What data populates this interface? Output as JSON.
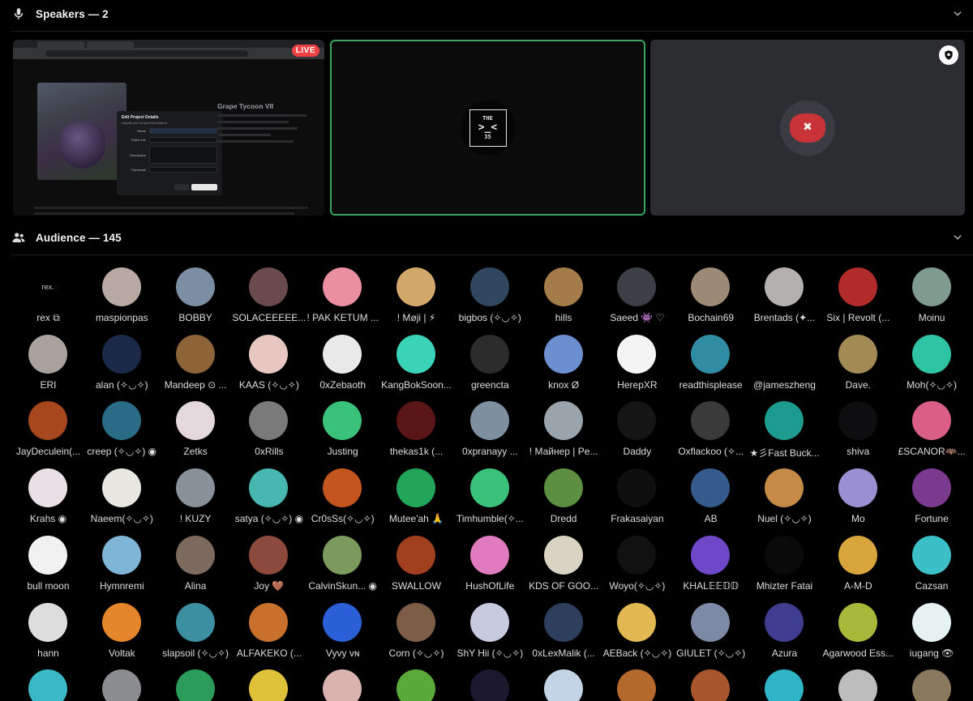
{
  "speakers": {
    "title": "Speakers — 2",
    "icon": "microphone-icon",
    "screen_share": {
      "live_label": "LIVE",
      "side_title": "Grape Tycoon VII",
      "modal_title": "Edit Project Details",
      "modal_subtitle": "Update your project information",
      "field_labels": [
        "Name",
        "Token Info",
        "Description",
        "Thumbnail"
      ],
      "cancel_label": "Cancel",
      "update_label": "Update Project"
    },
    "tiles": [
      {
        "logo_top": "THE",
        "logo_mid": ">_<",
        "logo_bottom": "35",
        "speaking": true
      },
      {
        "moderator": true
      }
    ]
  },
  "audience": {
    "title": "Audience — 145",
    "icon": "people-icon",
    "first_avatar_text": "rex.",
    "members": [
      {
        "name": "rex ⧉",
        "color": "#000000"
      },
      {
        "name": "maspionpas",
        "color": "#b9a9a3"
      },
      {
        "name": "BOBBY",
        "color": "#7c8ea3"
      },
      {
        "name": "SOLACEEEEE...",
        "color": "#6b4a4e"
      },
      {
        "name": "! PAK KETUM ...",
        "color": "#e98fa0"
      },
      {
        "name": "! Møji | ⚡",
        "color": "#d2a86b"
      },
      {
        "name": "bigbos (✧◡✧)",
        "color": "#31465f"
      },
      {
        "name": "hills",
        "color": "#a47c4a"
      },
      {
        "name": "Saeed 👾 ♡",
        "color": "#3c4046"
      },
      {
        "name": "Bochain69",
        "color": "#9c8a76"
      },
      {
        "name": "Brentads (✦...",
        "color": "#b3b0ae"
      },
      {
        "name": "Six | Revolt (...",
        "color": "#b22b2b"
      },
      {
        "name": "Moinu",
        "color": "#7f9a8f"
      },
      {
        "name": "ERI",
        "color": "#a9a29c"
      },
      {
        "name": "alan (✧◡✧)",
        "color": "#1c2a4a"
      },
      {
        "name": "Mandeep ⊙ ...",
        "color": "#8c6438"
      },
      {
        "name": "KAAS (✧◡✧)",
        "color": "#e8c7c2"
      },
      {
        "name": "0xZebaoth",
        "color": "#e9e9e9"
      },
      {
        "name": "KangBokSoon...",
        "color": "#3bd3b8"
      },
      {
        "name": "greencta",
        "color": "#2c2c2c"
      },
      {
        "name": "knox Ø",
        "color": "#6c8fd2"
      },
      {
        "name": "HerepXR",
        "color": "#f4f4f4"
      },
      {
        "name": "readthisplease",
        "color": "#2f8ca3"
      },
      {
        "name": "@jameszheng",
        "color": "#000000"
      },
      {
        "name": "Dave.",
        "color": "#a28a54"
      },
      {
        "name": "Moh(✧◡✧)",
        "color": "#2ec4a3"
      },
      {
        "name": "JayDeculein(...",
        "color": "#a6471e"
      },
      {
        "name": "creep (✧◡✧) ◉",
        "color": "#2a6c86"
      },
      {
        "name": "Zetks",
        "color": "#e4d8dd"
      },
      {
        "name": "0xRills",
        "color": "#7a7a7a"
      },
      {
        "name": "Justing",
        "color": "#3ac27a"
      },
      {
        "name": "thekas1k (...",
        "color": "#5a1616"
      },
      {
        "name": "0xpranayy ...",
        "color": "#7e8fa0"
      },
      {
        "name": "! Майнер | Pe...",
        "color": "#9aa4ad"
      },
      {
        "name": "Daddy",
        "color": "#151515"
      },
      {
        "name": "Oxflackoo (✧...",
        "color": "#3a3a3a"
      },
      {
        "name": "★彡Fast Buck...",
        "color": "#1d9b8f"
      },
      {
        "name": "shiva",
        "color": "#0e0e10"
      },
      {
        "name": "£SCANOR🦇...",
        "color": "#d95f87"
      },
      {
        "name": "Krahs ◉",
        "color": "#e8e0e4"
      },
      {
        "name": "Naeem(✧◡✧)",
        "color": "#e9e7e2"
      },
      {
        "name": "! KUZY",
        "color": "#88919a"
      },
      {
        "name": "satya (✧◡✧) ◉",
        "color": "#47b7b0"
      },
      {
        "name": "Cr0sSs(✧◡✧)",
        "color": "#c4551f"
      },
      {
        "name": "Mutee'ah 🙏",
        "color": "#23a559"
      },
      {
        "name": "Timhumble(✧...",
        "color": "#3ac27a"
      },
      {
        "name": "Dredd",
        "color": "#5d8f43"
      },
      {
        "name": "Frakasaiyan",
        "color": "#0f0f0f"
      },
      {
        "name": "AB",
        "color": "#345b8b"
      },
      {
        "name": "Nuel (✧◡✧)",
        "color": "#c58a46"
      },
      {
        "name": "Mo",
        "color": "#9a8fd0"
      },
      {
        "name": "Fortune",
        "color": "#7a3a8e"
      },
      {
        "name": "bull moon",
        "color": "#f1f1f1"
      },
      {
        "name": "Hymnremi",
        "color": "#7fb6d8"
      },
      {
        "name": "Alina",
        "color": "#7c6a5e"
      },
      {
        "name": "Joy 🤎",
        "color": "#8c4a3c"
      },
      {
        "name": "CalvinSkun... ◉",
        "color": "#7d9a5e"
      },
      {
        "name": "SWALLOW",
        "color": "#a0401f"
      },
      {
        "name": "HushOfLife",
        "color": "#e07bc0"
      },
      {
        "name": "KDS OF GOO...",
        "color": "#d9d3c3"
      },
      {
        "name": "Woyo(✧◡✧)",
        "color": "#111111"
      },
      {
        "name": "KHAL𝔼𝔼𝔻𝔻",
        "color": "#6e48c9"
      },
      {
        "name": "Mhizter Fatai",
        "color": "#0a0a0a"
      },
      {
        "name": "A-M-D",
        "color": "#d8a43c"
      },
      {
        "name": "Cazsan",
        "color": "#3bc0c8"
      },
      {
        "name": "hann",
        "color": "#dddddd"
      },
      {
        "name": "Voltak",
        "color": "#e5852c"
      },
      {
        "name": "slapsoil (✧◡✧)",
        "color": "#3c8fa0"
      },
      {
        "name": "ALFAKEKO (...",
        "color": "#c8702c"
      },
      {
        "name": "Vyvy ᴠɴ",
        "color": "#2a5fd8"
      },
      {
        "name": "Corn (✧◡✧)",
        "color": "#7d5d47"
      },
      {
        "name": "ShY Hii (✧◡✧)",
        "color": "#c7cbe0"
      },
      {
        "name": "0xLexMalik (...",
        "color": "#2d3f5d"
      },
      {
        "name": "AEBack (✧◡✧)",
        "color": "#e1b851"
      },
      {
        "name": "GIULET (✧◡✧)",
        "color": "#7c8aa5"
      },
      {
        "name": "Azura",
        "color": "#3f3d8f"
      },
      {
        "name": "Agarwood Ess...",
        "color": "#a8b83a"
      },
      {
        "name": "iugang 👁",
        "color": "#e6f1f1"
      },
      {
        "name": "",
        "color": "#3bb8c5"
      },
      {
        "name": "",
        "color": "#8b8d90"
      },
      {
        "name": "",
        "color": "#2c9c5a"
      },
      {
        "name": "",
        "color": "#e0c23a"
      },
      {
        "name": "",
        "color": "#d8b3b0"
      },
      {
        "name": "",
        "color": "#58a83a"
      },
      {
        "name": "",
        "color": "#1c1830"
      },
      {
        "name": "",
        "color": "#c2d4e6"
      },
      {
        "name": "",
        "color": "#b3692c"
      },
      {
        "name": "",
        "color": "#a8562c"
      },
      {
        "name": "",
        "color": "#2fb3c7"
      },
      {
        "name": "",
        "color": "#bdbdbd"
      },
      {
        "name": "",
        "color": "#8a7a5d"
      }
    ]
  }
}
